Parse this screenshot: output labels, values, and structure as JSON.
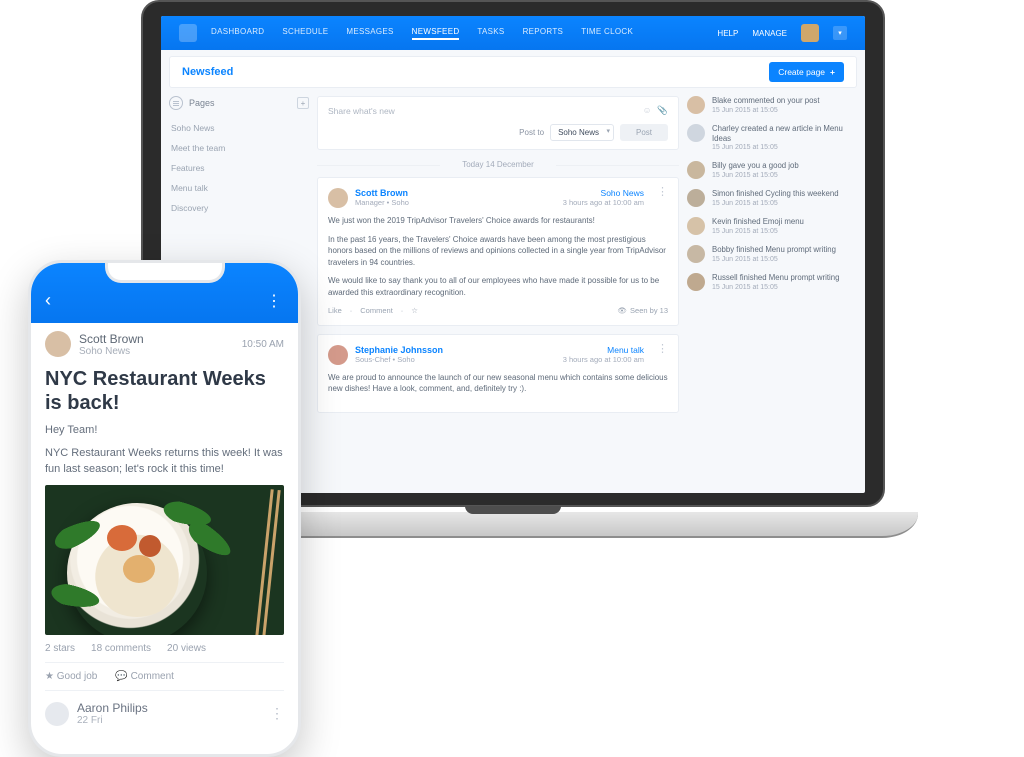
{
  "nav": {
    "items": [
      "DASHBOARD",
      "SCHEDULE",
      "MESSAGES",
      "NEWSFEED",
      "TASKS",
      "REPORTS",
      "TIME CLOCK"
    ],
    "active": 3,
    "help": "HELP",
    "manage": "MANAGE"
  },
  "header": {
    "title": "Newsfeed",
    "create_label": "Create page"
  },
  "sidebar": {
    "label": "Pages",
    "items": [
      "Soho News",
      "Meet the team",
      "Features",
      "Menu talk",
      "Discovery"
    ]
  },
  "compose": {
    "placeholder": "Share what's new",
    "post_to_label": "Post to",
    "selected_page": "Soho News",
    "post_button": "Post"
  },
  "date_separator": "Today 14 December",
  "posts": [
    {
      "author": "Scott Brown",
      "role": "Manager • Soho",
      "page": "Soho News",
      "time": "3 hours ago at 10:00 am",
      "paragraphs": [
        "We just won the 2019 TripAdvisor Travelers' Choice awards for restaurants!",
        "In the past 16 years, the Travelers' Choice awards have been among the most prestigious honors based on the millions of reviews and opinions collected in a single year from TripAdvisor travelers in 94 countries.",
        "We would like to say thank you to all of our employees who have made it possible for us to be awarded this extraordinary recognition."
      ],
      "like": "Like",
      "comment": "Comment",
      "seen": "Seen by 13"
    },
    {
      "author": "Stephanie Johnsson",
      "role": "Sous-Chef • Soho",
      "page": "Menu talk",
      "time": "3 hours ago at 10:00 am",
      "paragraphs": [
        "We are proud to announce the launch of our new seasonal menu which contains some delicious new dishes! Have a look, comment, and, definitely try :)."
      ]
    }
  ],
  "activity": [
    {
      "text": "Blake commented on your post",
      "time": "15 Jun 2015 at 15:05"
    },
    {
      "text": "Charley created a new article in Menu Ideas",
      "time": "15 Jun 2015 at 15:05"
    },
    {
      "text": "Billy gave you a good job",
      "time": "15 Jun 2015 at 15:05"
    },
    {
      "text": "Simon finished Cycling this weekend",
      "time": "15 Jun 2015 at 15:05"
    },
    {
      "text": "Kevin finished Emoji menu",
      "time": "15 Jun 2015 at 15:05"
    },
    {
      "text": "Bobby finished Menu prompt writing",
      "time": "15 Jun 2015 at 15:05"
    },
    {
      "text": "Russell finished Menu prompt writing",
      "time": "15 Jun 2015 at 15:05"
    }
  ],
  "mobile": {
    "author": "Scott Brown",
    "page": "Soho News",
    "time": "10:50 AM",
    "title": "NYC Restaurant Weeks is back!",
    "greeting": "Hey Team!",
    "body": "NYC Restaurant Weeks returns this week! It was fun last season; let's rock it this time!",
    "stars": "2 stars",
    "comments": "18 comments",
    "views": "20 views",
    "good_job": "Good job",
    "comment": "Comment",
    "next_author": "Aaron Philips",
    "next_sub": "22 Fri"
  }
}
